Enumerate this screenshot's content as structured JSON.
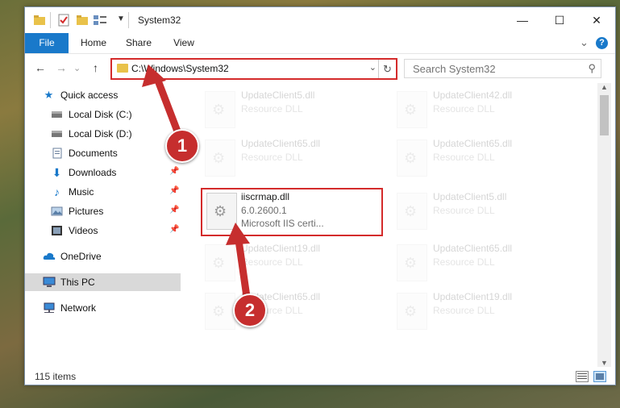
{
  "window": {
    "title": "System32",
    "minimize": "—",
    "maximize": "☐",
    "close": "✕"
  },
  "ribbon": {
    "tabs": [
      "File",
      "Home",
      "Share",
      "View"
    ],
    "collapse": "⌄",
    "help": "?"
  },
  "navigation": {
    "back": "←",
    "forward": "→",
    "recent": "⌄",
    "up": "↑",
    "address_path": "C:\\Windows\\System32",
    "address_dropdown": "⌄",
    "refresh": "↻",
    "search_placeholder": "Search System32"
  },
  "sidebar": {
    "items": [
      {
        "label": "Quick access",
        "icon": "star-icon"
      },
      {
        "label": "Local Disk (C:)",
        "icon": "drive-icon"
      },
      {
        "label": "Local Disk (D:)",
        "icon": "drive-icon"
      },
      {
        "label": "Documents",
        "icon": "documents-icon"
      },
      {
        "label": "Downloads",
        "icon": "download-icon"
      },
      {
        "label": "Music",
        "icon": "music-icon"
      },
      {
        "label": "Pictures",
        "icon": "pictures-icon"
      },
      {
        "label": "Videos",
        "icon": "videos-icon"
      },
      {
        "label": "OneDrive",
        "icon": "cloud-icon"
      },
      {
        "label": "This PC",
        "icon": "computer-icon"
      },
      {
        "label": "Network",
        "icon": "network-icon"
      }
    ]
  },
  "files": {
    "tiles": [
      {
        "name": "UpdateClient5.dll",
        "type": "Resource DLL"
      },
      {
        "name": "UpdateClient42.dll",
        "type": "Resource DLL"
      },
      {
        "name": "UpdateClient65.dll",
        "type": "Resource DLL"
      },
      {
        "name": "UpdateClient65.dll",
        "type": "Resource DLL"
      },
      {
        "name": "UpdateClient5.dll",
        "type": "Resource DLL"
      },
      {
        "name": "UpdateClient19.dll",
        "type": "Resource DLL"
      },
      {
        "name": "UpdateClient65.dll",
        "type": "Resource DLL"
      },
      {
        "name": "UpdateClient65.dll",
        "type": "Resource DLL"
      },
      {
        "name": "UpdateClient19.dll",
        "type": "Resource DLL"
      }
    ],
    "highlighted": {
      "name": "iiscrmap.dll",
      "version": "6.0.2600.1",
      "description": "Microsoft IIS certi..."
    }
  },
  "status": {
    "item_count": "115 items"
  },
  "annotations": {
    "step1": "1",
    "step2": "2",
    "color": "#c62e2e"
  }
}
